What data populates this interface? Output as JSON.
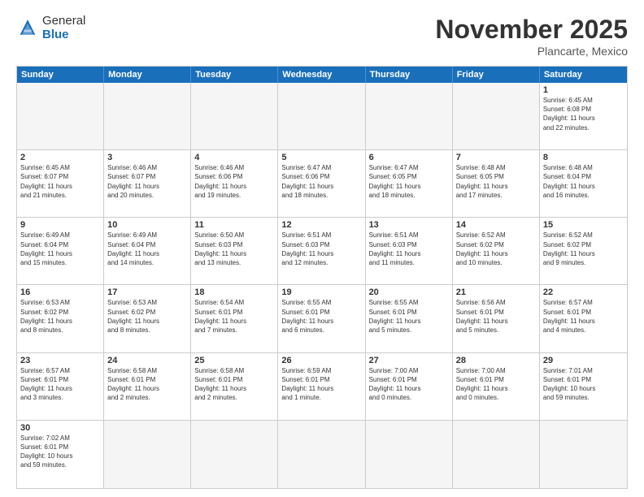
{
  "header": {
    "logo_general": "General",
    "logo_blue": "Blue",
    "month_title": "November 2025",
    "location": "Plancarte, Mexico"
  },
  "days_of_week": [
    "Sunday",
    "Monday",
    "Tuesday",
    "Wednesday",
    "Thursday",
    "Friday",
    "Saturday"
  ],
  "cells": [
    {
      "day": "",
      "empty": true,
      "info": ""
    },
    {
      "day": "",
      "empty": true,
      "info": ""
    },
    {
      "day": "",
      "empty": true,
      "info": ""
    },
    {
      "day": "",
      "empty": true,
      "info": ""
    },
    {
      "day": "",
      "empty": true,
      "info": ""
    },
    {
      "day": "",
      "empty": true,
      "info": ""
    },
    {
      "day": "1",
      "empty": false,
      "info": "Sunrise: 6:45 AM\nSunset: 6:08 PM\nDaylight: 11 hours\nand 22 minutes."
    },
    {
      "day": "2",
      "empty": false,
      "info": "Sunrise: 6:45 AM\nSunset: 6:07 PM\nDaylight: 11 hours\nand 21 minutes."
    },
    {
      "day": "3",
      "empty": false,
      "info": "Sunrise: 6:46 AM\nSunset: 6:07 PM\nDaylight: 11 hours\nand 20 minutes."
    },
    {
      "day": "4",
      "empty": false,
      "info": "Sunrise: 6:46 AM\nSunset: 6:06 PM\nDaylight: 11 hours\nand 19 minutes."
    },
    {
      "day": "5",
      "empty": false,
      "info": "Sunrise: 6:47 AM\nSunset: 6:06 PM\nDaylight: 11 hours\nand 18 minutes."
    },
    {
      "day": "6",
      "empty": false,
      "info": "Sunrise: 6:47 AM\nSunset: 6:05 PM\nDaylight: 11 hours\nand 18 minutes."
    },
    {
      "day": "7",
      "empty": false,
      "info": "Sunrise: 6:48 AM\nSunset: 6:05 PM\nDaylight: 11 hours\nand 17 minutes."
    },
    {
      "day": "8",
      "empty": false,
      "info": "Sunrise: 6:48 AM\nSunset: 6:04 PM\nDaylight: 11 hours\nand 16 minutes."
    },
    {
      "day": "9",
      "empty": false,
      "info": "Sunrise: 6:49 AM\nSunset: 6:04 PM\nDaylight: 11 hours\nand 15 minutes."
    },
    {
      "day": "10",
      "empty": false,
      "info": "Sunrise: 6:49 AM\nSunset: 6:04 PM\nDaylight: 11 hours\nand 14 minutes."
    },
    {
      "day": "11",
      "empty": false,
      "info": "Sunrise: 6:50 AM\nSunset: 6:03 PM\nDaylight: 11 hours\nand 13 minutes."
    },
    {
      "day": "12",
      "empty": false,
      "info": "Sunrise: 6:51 AM\nSunset: 6:03 PM\nDaylight: 11 hours\nand 12 minutes."
    },
    {
      "day": "13",
      "empty": false,
      "info": "Sunrise: 6:51 AM\nSunset: 6:03 PM\nDaylight: 11 hours\nand 11 minutes."
    },
    {
      "day": "14",
      "empty": false,
      "info": "Sunrise: 6:52 AM\nSunset: 6:02 PM\nDaylight: 11 hours\nand 10 minutes."
    },
    {
      "day": "15",
      "empty": false,
      "info": "Sunrise: 6:52 AM\nSunset: 6:02 PM\nDaylight: 11 hours\nand 9 minutes."
    },
    {
      "day": "16",
      "empty": false,
      "info": "Sunrise: 6:53 AM\nSunset: 6:02 PM\nDaylight: 11 hours\nand 8 minutes."
    },
    {
      "day": "17",
      "empty": false,
      "info": "Sunrise: 6:53 AM\nSunset: 6:02 PM\nDaylight: 11 hours\nand 8 minutes."
    },
    {
      "day": "18",
      "empty": false,
      "info": "Sunrise: 6:54 AM\nSunset: 6:01 PM\nDaylight: 11 hours\nand 7 minutes."
    },
    {
      "day": "19",
      "empty": false,
      "info": "Sunrise: 6:55 AM\nSunset: 6:01 PM\nDaylight: 11 hours\nand 6 minutes."
    },
    {
      "day": "20",
      "empty": false,
      "info": "Sunrise: 6:55 AM\nSunset: 6:01 PM\nDaylight: 11 hours\nand 5 minutes."
    },
    {
      "day": "21",
      "empty": false,
      "info": "Sunrise: 6:56 AM\nSunset: 6:01 PM\nDaylight: 11 hours\nand 5 minutes."
    },
    {
      "day": "22",
      "empty": false,
      "info": "Sunrise: 6:57 AM\nSunset: 6:01 PM\nDaylight: 11 hours\nand 4 minutes."
    },
    {
      "day": "23",
      "empty": false,
      "info": "Sunrise: 6:57 AM\nSunset: 6:01 PM\nDaylight: 11 hours\nand 3 minutes."
    },
    {
      "day": "24",
      "empty": false,
      "info": "Sunrise: 6:58 AM\nSunset: 6:01 PM\nDaylight: 11 hours\nand 2 minutes."
    },
    {
      "day": "25",
      "empty": false,
      "info": "Sunrise: 6:58 AM\nSunset: 6:01 PM\nDaylight: 11 hours\nand 2 minutes."
    },
    {
      "day": "26",
      "empty": false,
      "info": "Sunrise: 6:59 AM\nSunset: 6:01 PM\nDaylight: 11 hours\nand 1 minute."
    },
    {
      "day": "27",
      "empty": false,
      "info": "Sunrise: 7:00 AM\nSunset: 6:01 PM\nDaylight: 11 hours\nand 0 minutes."
    },
    {
      "day": "28",
      "empty": false,
      "info": "Sunrise: 7:00 AM\nSunset: 6:01 PM\nDaylight: 11 hours\nand 0 minutes."
    },
    {
      "day": "29",
      "empty": false,
      "info": "Sunrise: 7:01 AM\nSunset: 6:01 PM\nDaylight: 10 hours\nand 59 minutes."
    },
    {
      "day": "30",
      "empty": false,
      "info": "Sunrise: 7:02 AM\nSunset: 6:01 PM\nDaylight: 10 hours\nand 59 minutes."
    },
    {
      "day": "",
      "empty": true,
      "info": ""
    },
    {
      "day": "",
      "empty": true,
      "info": ""
    },
    {
      "day": "",
      "empty": true,
      "info": ""
    },
    {
      "day": "",
      "empty": true,
      "info": ""
    },
    {
      "day": "",
      "empty": true,
      "info": ""
    },
    {
      "day": "",
      "empty": true,
      "info": ""
    }
  ]
}
